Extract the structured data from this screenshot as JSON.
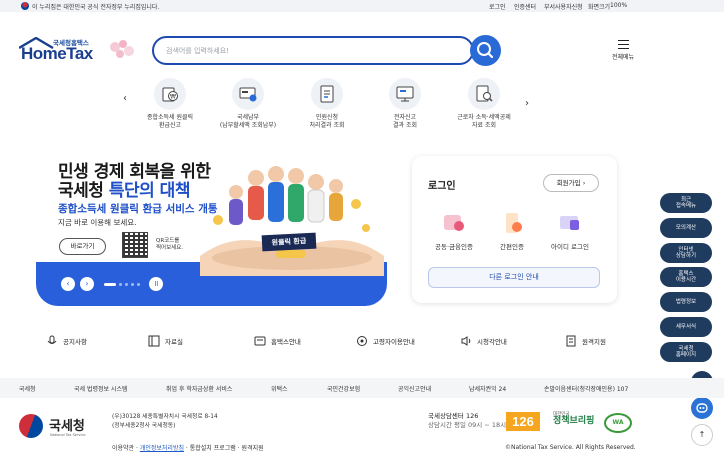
{
  "govbar": {
    "notice": "이 누리집은 대한민국 공식 전자정부 누리집입니다.",
    "login": "로그인",
    "cert_center": "인증센터",
    "dept_user": "부서사용자신청",
    "zoom_label": "화면크기",
    "zoom_value": "100%"
  },
  "header": {
    "logo_sub": "국세청홈택스",
    "logo_main": "HomeTax",
    "search_placeholder": "검색어를 입력하세요!",
    "menu_label": "전체메뉴"
  },
  "quick_services": [
    {
      "label": "종합소득세 원클릭\n환급신고",
      "icon": "refund-icon"
    },
    {
      "label": "국세납부\n(납부할세액 조회납부)",
      "icon": "tax-payment-icon"
    },
    {
      "label": "민원신청\n처리결과 조회",
      "icon": "document-icon"
    },
    {
      "label": "전자신고\n결과 조회",
      "icon": "monitor-icon"
    },
    {
      "label": "근로자 소득·세액공제\n자료 조회",
      "icon": "search-doc-icon"
    }
  ],
  "hero": {
    "line1": "민생 경제 회복을 위한",
    "line2_pre": "국세청 ",
    "line2_hl": "특단의 대책",
    "sub": "종합소득세 원클릭 환급 서비스 개통",
    "sub2": "지금 바로 이용해 보세요.",
    "shortcut": "바로가기",
    "qr_text": "QR코드를\n찍어보세요.",
    "badge": "원클릭 환급"
  },
  "login": {
    "title": "로그인",
    "join": "회원가입",
    "certs": [
      "공동·금융인증",
      "간편인증",
      "아이디 로그인"
    ],
    "other": "다른 로그인 안내"
  },
  "side_menu": [
    "최근\n접속메뉴",
    "모의계산",
    "인터넷\n상담하기",
    "홈택스\n이용시간",
    "법령정보",
    "세무서식",
    "국세청\n홈페이지"
  ],
  "bottom_links": [
    {
      "label": "공지사항",
      "icon": "megaphone-icon"
    },
    {
      "label": "자료실",
      "icon": "archive-icon"
    },
    {
      "label": "홈택스안내",
      "icon": "info-icon"
    },
    {
      "label": "고령자이용안내",
      "icon": "elderly-icon"
    },
    {
      "label": "시청각안내",
      "icon": "sound-icon"
    },
    {
      "label": "원격지원",
      "icon": "remote-icon"
    }
  ],
  "footer_links": [
    "국세청",
    "국세 법령정보 시스템",
    "취업 후 학자금상환 서비스",
    "위택스",
    "국민건강보험",
    "공익신고안내",
    "납세자권익 24",
    "손말이음센터(청각장애인용) 107"
  ],
  "footer": {
    "org": "국세청",
    "org_en": "National Tax Service",
    "address": "(우)30128 세종특별자치시 국세청로 8-14\n(정부세종2청사 국세청동)",
    "privacy_pre": "이용약관",
    "privacy": "개인정보처리방침",
    "program": "통합설치 프로그램",
    "remote": "원격지원",
    "call_title": "국세상담센터 126",
    "call_hours": "상담시간 평일 09시 ~ 18시",
    "n126": "126",
    "jichaek_small": "대한민국",
    "jichaek": "정책브리핑",
    "waa": "WA",
    "copyright": "©National Tax Service. All Rights Reserved."
  }
}
